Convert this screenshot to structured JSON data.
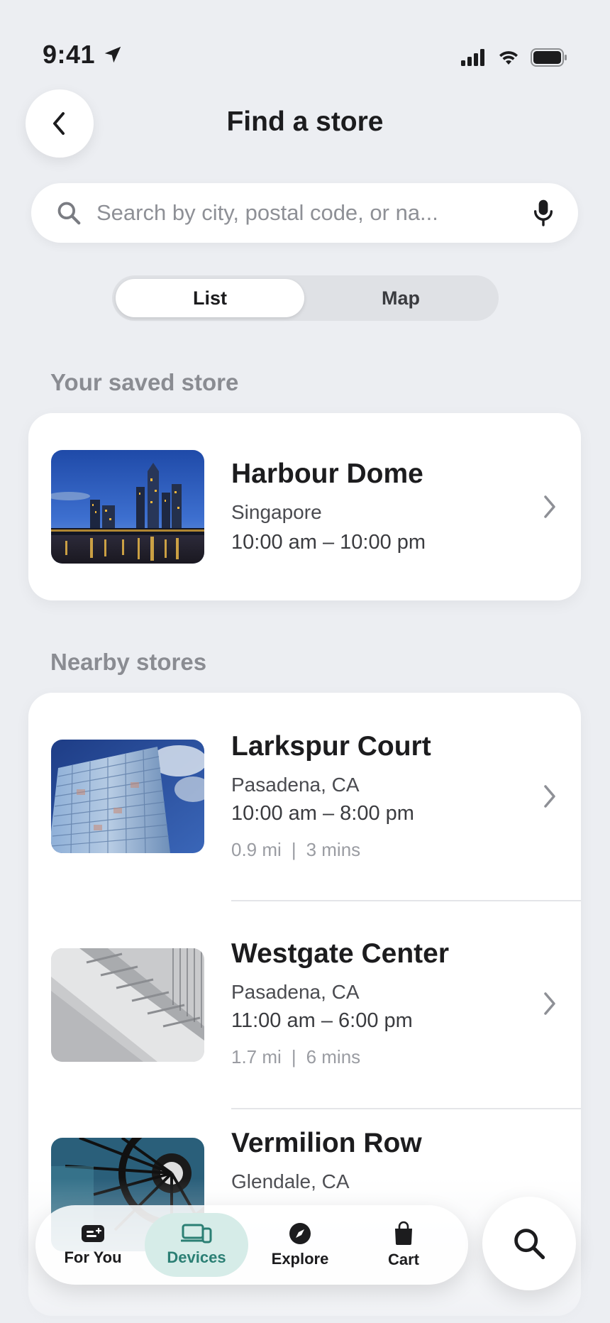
{
  "status_bar": {
    "time": "9:41",
    "location_icon": "location-arrow-icon",
    "signal_icon": "signal-icon",
    "wifi_icon": "wifi-icon",
    "battery_icon": "battery-icon"
  },
  "header": {
    "title": "Find a store",
    "back_icon": "chevron-left-icon"
  },
  "search": {
    "placeholder": "Search by city, postal code, or na...",
    "value": "",
    "search_icon": "search-icon",
    "mic_icon": "microphone-icon"
  },
  "view_toggle": {
    "options": [
      "List",
      "Map"
    ],
    "selected": "List"
  },
  "saved_section": {
    "label": "Your saved store",
    "store": {
      "name": "Harbour Dome",
      "city": "Singapore",
      "hours": "10:00 am – 10:00 pm",
      "image": "city-skyline-night"
    }
  },
  "nearby_section": {
    "label": "Nearby stores",
    "stores": [
      {
        "name": "Larkspur Court",
        "city": "Pasadena, CA",
        "hours": "10:00 am – 8:00 pm",
        "distance": "0.9 mi",
        "separator": "|",
        "time": "3 mins",
        "image": "glass-tower"
      },
      {
        "name": "Westgate Center",
        "city": "Pasadena, CA",
        "hours": "11:00 am – 6:00 pm",
        "distance": "1.7 mi",
        "separator": "|",
        "time": "6 mins",
        "image": "spiral-staircase"
      },
      {
        "name": "Vermilion Row",
        "city": "Glendale, CA",
        "image": "ferris-wheel"
      }
    ]
  },
  "tab_bar": {
    "tabs": [
      {
        "label": "For You",
        "icon": "for-you-icon"
      },
      {
        "label": "Devices",
        "icon": "devices-icon"
      },
      {
        "label": "Explore",
        "icon": "compass-icon"
      },
      {
        "label": "Cart",
        "icon": "bag-icon"
      }
    ],
    "selected": "Devices",
    "search_icon": "search-icon"
  },
  "colors": {
    "background": "#eceef2",
    "accent": "#2b7f74",
    "accent_bg": "#d6ece8"
  }
}
